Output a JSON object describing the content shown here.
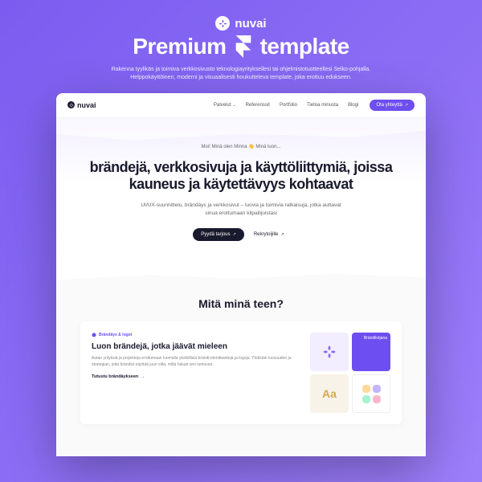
{
  "brand": "nuvai",
  "title_left": "Premium",
  "title_right": "template",
  "subtitle": "Rakenna tyylikäs ja toimiva verkkosivusto teknologiayrityksellesi tai ohjelmistotuotteellesi Selko-pohjalla. Helppokäyttöinen, moderni ja visuaalisesti houkutteleva template, joka erottuu edukseen.",
  "nav": {
    "logo": "nuvai",
    "items": [
      "Palvelut",
      "Referenssit",
      "Portfolio",
      "Tietoa minusta",
      "Blogi"
    ],
    "cta": "Ota yhteyttä"
  },
  "hero": {
    "greeting_pre": "Moi! Minä olen Minna",
    "greeting_post": "Minä luon...",
    "heading": "brändejä, verkkosivuja ja käyttöliittymiä, joissa kauneus ja käytettävyys kohtaavat",
    "sub": "UI/UX-suunnittelu, brändäys ja verkkosivut – luovia ja toimivia ratkaisuja, jotka auttavat sinua erottumaan kilpailijoistasi",
    "btn_primary": "Pyydä tarjous",
    "btn_secondary": "Rekrytoijille"
  },
  "section2": {
    "title": "Mitä minä teen?",
    "card": {
      "tag": "Brändäys & logot",
      "title": "Luon brändejä, jotka jäävät mieleen",
      "desc": "Autan yrityksiä ja projekteja erottumaan luomalla yksilöllisiä brändi-identiteettejä ja logoja. Yhdistän luovuuden ja strategian, jotta brändisi näyttää juuri siltä, miltä haluat sen tuntuvan.",
      "link": "Tutustu brändäykseen",
      "tile2_text": "Brändikirjana"
    }
  }
}
